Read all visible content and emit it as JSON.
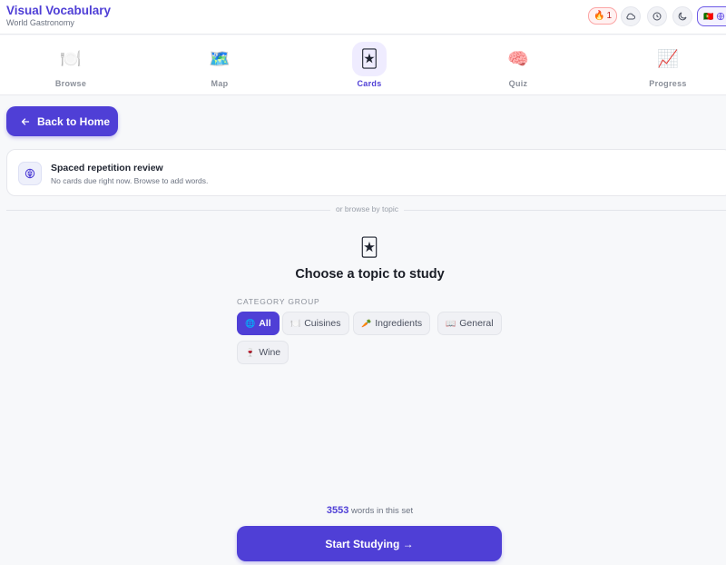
{
  "header": {
    "title": "Visual Vocabulary",
    "subtitle": "World Gastronomy",
    "streak_icon": "🔥",
    "streak_count": "1",
    "buttons": [
      "cloud-icon",
      "sync-icon",
      "moon-icon"
    ],
    "language_flag": "🇵🇹",
    "language_icon": "globe-icon"
  },
  "nav": {
    "items": [
      {
        "label": "Browse",
        "emoji": "🍽️"
      },
      {
        "label": "Map",
        "emoji": "🗺️"
      },
      {
        "label": "Cards",
        "emoji": "🃏"
      },
      {
        "label": "Quiz",
        "emoji": "🧠"
      },
      {
        "label": "Progress",
        "emoji": "📈"
      }
    ],
    "active": "Cards"
  },
  "back_button": {
    "label": "Back to Home",
    "icon": "arrow-left-icon"
  },
  "srs": {
    "title": "Spaced repetition review",
    "subtitle": "No cards due right now. Browse to add words.",
    "icon": "brain-icon"
  },
  "divider_label": "or browse by topic",
  "topic": {
    "emoji": "🃏",
    "title": "Choose a topic to study"
  },
  "category": {
    "label": "CATEGORY GROUP",
    "chips": [
      {
        "label": "All",
        "icon": "🌐",
        "active": true
      },
      {
        "label": "Cuisines",
        "icon": "🍽️",
        "active": false
      },
      {
        "label": "Ingredients",
        "icon": "🥕",
        "active": false
      },
      {
        "label": "General",
        "icon": "📖",
        "active": false
      },
      {
        "label": "Wine",
        "icon": "🍷",
        "active": false
      }
    ]
  },
  "footer": {
    "count": "3553",
    "count_suffix": "words in this set",
    "start_label": "Start Studying →"
  },
  "colors": {
    "accent": "#4f3fd6",
    "background": "#f7f8fa"
  }
}
